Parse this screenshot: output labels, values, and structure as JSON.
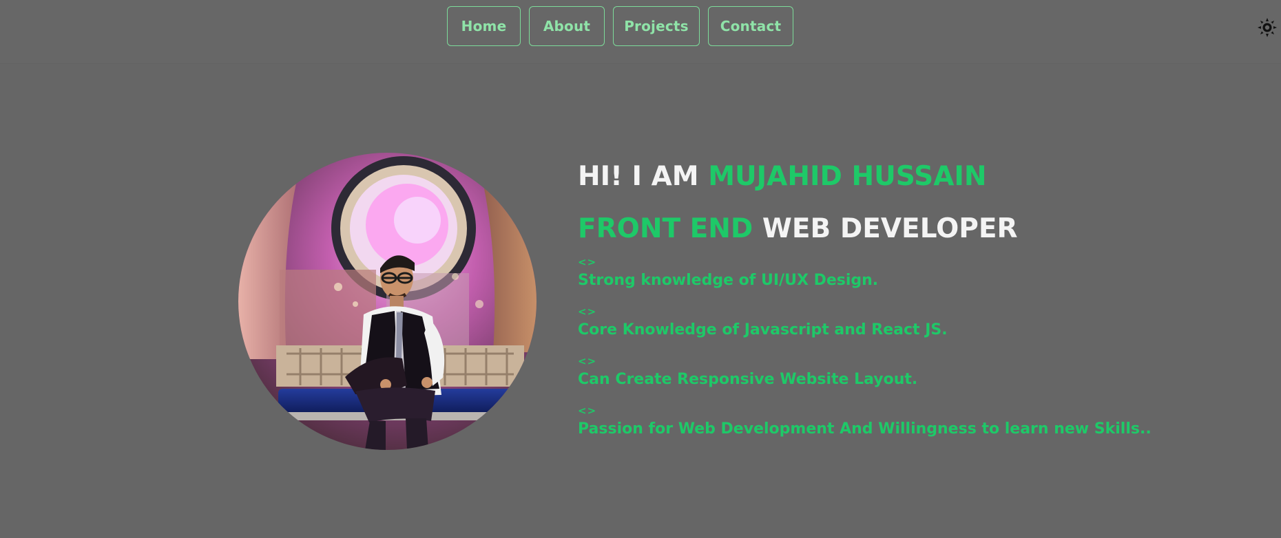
{
  "nav": {
    "items": [
      {
        "label": "Home"
      },
      {
        "label": "About"
      },
      {
        "label": "Projects"
      },
      {
        "label": "Contact"
      }
    ],
    "theme_toggle_icon": "sun-icon"
  },
  "hero": {
    "greeting_prefix": "HI! I AM ",
    "name": "MUJAHID HUSSAIN",
    "role_highlight": "FRONT END",
    "role_rest": " WEB DEVELOPER",
    "skill_marker": "<>",
    "skills": [
      {
        "text": "Strong knowledge of UI/UX Design."
      },
      {
        "text": "Core Knowledge of Javascript and React JS."
      },
      {
        "text": "Can Create Responsive Website Layout."
      },
      {
        "text": "Passion for Web Development And Willingness to learn new Skills.."
      }
    ]
  },
  "colors": {
    "background": "#666666",
    "accent": "#1ec968",
    "nav_border": "#7ddc9a",
    "text_light": "#f4f4f4"
  }
}
